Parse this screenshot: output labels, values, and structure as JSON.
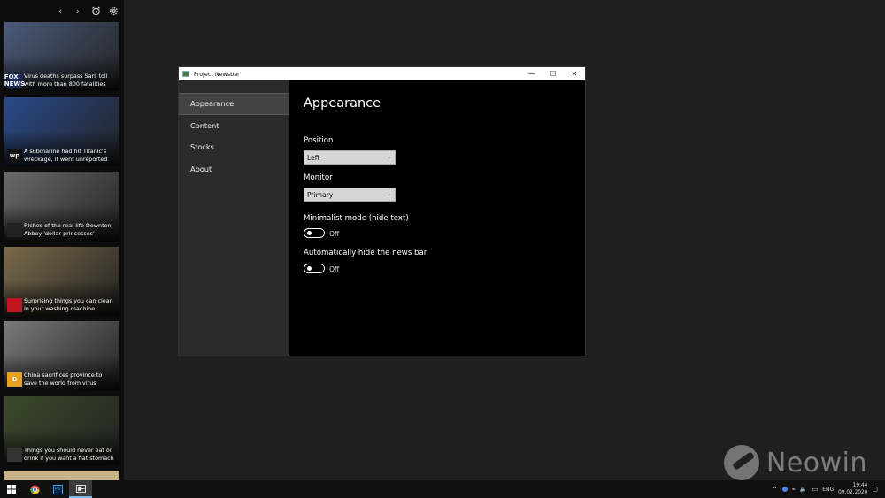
{
  "newsbar": {
    "icons": [
      "chevron-left-icon",
      "chevron-right-icon",
      "alarm-clock-icon",
      "gear-icon"
    ],
    "articles": [
      {
        "title": "Virus deaths surpass Sars toll with more than 800 fatalities",
        "source_logo": "FOX NEWS",
        "color": "#4a5a7a"
      },
      {
        "title": "A submarine had hit Titanic's wreckage, it went unreported",
        "source_logo": "wp",
        "color": "#2a4a8a"
      },
      {
        "title": "Riches of the real-life Downton Abbey 'dollar princesses'",
        "source_logo": "",
        "color": "#6a6a6a"
      },
      {
        "title": "Surprising things you can clean in your washing machine",
        "source_logo": "",
        "color": "#7a6a4a"
      },
      {
        "title": "China sacrifices province to save the world from virus",
        "source_logo": "B",
        "color": "#7a7a7a"
      },
      {
        "title": "Things you should never eat or drink if you want a flat stomach",
        "source_logo": "",
        "color": "#3a4a2a"
      }
    ]
  },
  "window": {
    "title": "Project Newsbar",
    "controls": {
      "minimize": "—",
      "maximize": "☐",
      "close": "✕"
    },
    "nav": [
      {
        "label": "Appearance",
        "active": true
      },
      {
        "label": "Content",
        "active": false
      },
      {
        "label": "Stocks",
        "active": false
      },
      {
        "label": "About",
        "active": false
      }
    ],
    "page": {
      "title": "Appearance",
      "position_label": "Position",
      "position_value": "Left",
      "monitor_label": "Monitor",
      "monitor_value": "Primary",
      "minimalist_label": "Minimalist mode  (hide text)",
      "minimalist_state": "Off",
      "autohide_label": "Automatically hide the news bar",
      "autohide_state": "Off"
    }
  },
  "watermark": {
    "text": "Neowin"
  },
  "taskbar": {
    "apps": [
      "windows-start-icon",
      "chrome-icon",
      "photoshop-icon",
      "newsbar-app-icon"
    ],
    "language": "ENG",
    "time": "19:44",
    "date": "09.02.2020"
  },
  "colors": {
    "accent": "#76b9ed",
    "nav_bg": "#2b2b2b",
    "content_bg": "#000000"
  }
}
